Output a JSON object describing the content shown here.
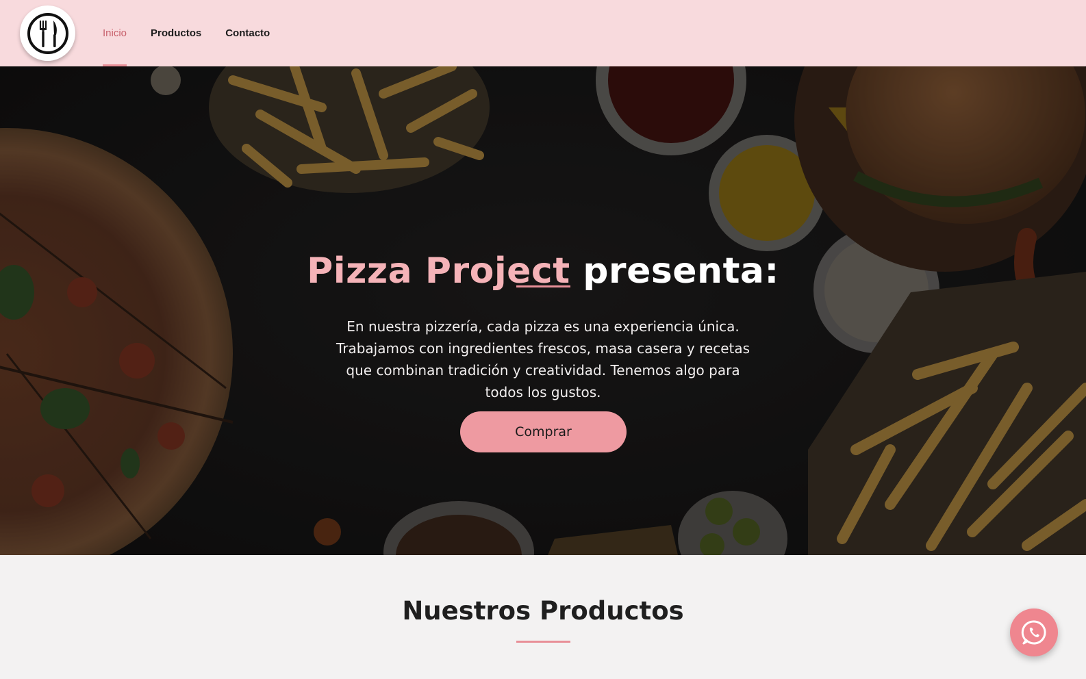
{
  "header": {
    "logo_icon": "fork-knife-icon",
    "nav": [
      {
        "label": "Inicio",
        "active": true
      },
      {
        "label": "Productos",
        "active": false
      },
      {
        "label": "Contacto",
        "active": false
      }
    ]
  },
  "hero": {
    "title_brand": "Pizza Project",
    "title_rest": "presenta:",
    "description": "En nuestra pizzería, cada pizza es una experiencia única. Trabajamos con ingredientes frescos, masa casera y recetas que combinan tradición y creatividad. Tenemos algo para todos los gustos.",
    "cta_label": "Comprar"
  },
  "products_section": {
    "title": "Nuestros Productos"
  },
  "floating": {
    "whatsapp_icon": "whatsapp-icon"
  },
  "colors": {
    "header_bg": "#f8dadd",
    "accent": "#e88f98",
    "brand_text": "#f5b3b8",
    "cta_bg": "#ee9aa1",
    "hero_bg": "#141313",
    "section_bg": "#f3f2f2"
  }
}
